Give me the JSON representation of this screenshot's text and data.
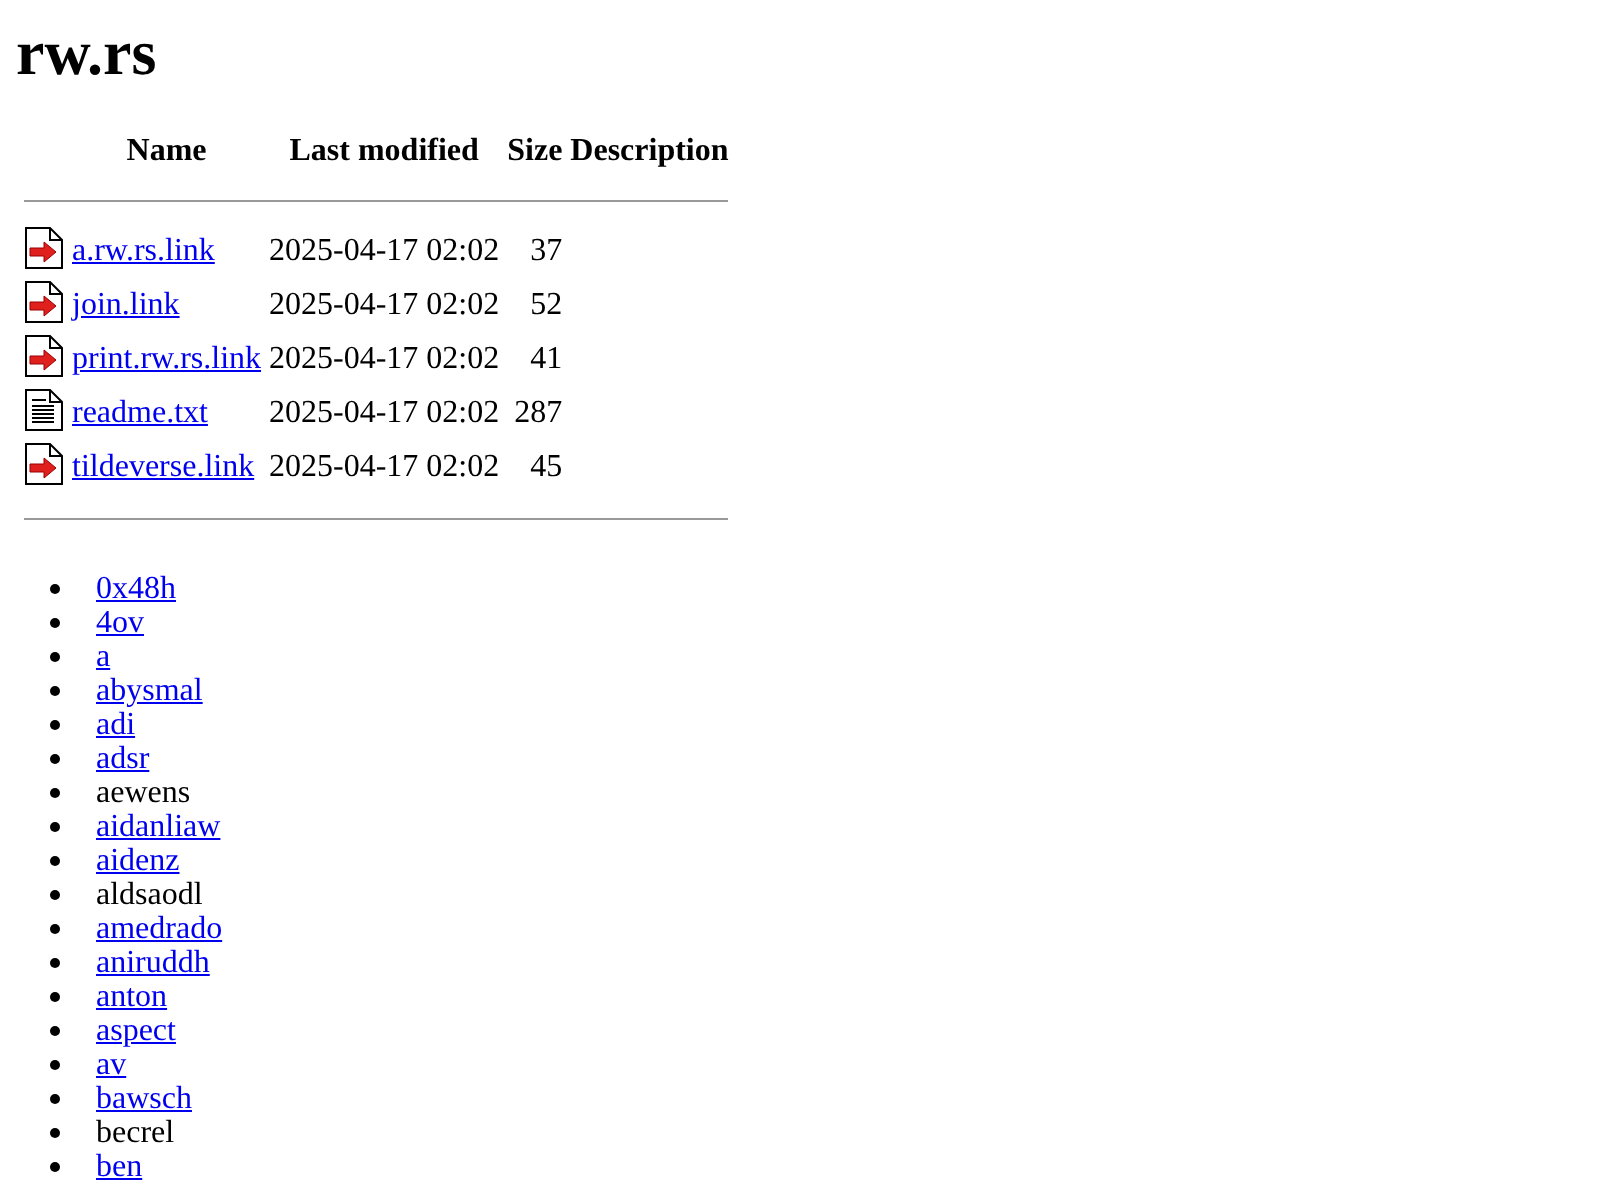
{
  "title": "rw.rs",
  "table": {
    "columns": [
      "Name",
      "Last modified",
      "Size",
      "Description"
    ],
    "rows": [
      {
        "kind": "link",
        "name": "a.rw.rs.link",
        "modified": "2025-04-17 02:02",
        "size": "37"
      },
      {
        "kind": "link",
        "name": "join.link",
        "modified": "2025-04-17 02:02",
        "size": "52"
      },
      {
        "kind": "link",
        "name": "print.rw.rs.link",
        "modified": "2025-04-17 02:02",
        "size": "41"
      },
      {
        "kind": "text",
        "name": "readme.txt",
        "modified": "2025-04-17 02:02",
        "size": "287"
      },
      {
        "kind": "link",
        "name": "tildeverse.link",
        "modified": "2025-04-17 02:02",
        "size": "45"
      }
    ]
  },
  "users": [
    {
      "name": "0x48h",
      "linked": true
    },
    {
      "name": "4ov",
      "linked": true
    },
    {
      "name": "a",
      "linked": true
    },
    {
      "name": "abysmal",
      "linked": true
    },
    {
      "name": "adi",
      "linked": true
    },
    {
      "name": "adsr",
      "linked": true
    },
    {
      "name": "aewens",
      "linked": false
    },
    {
      "name": "aidanliaw",
      "linked": true
    },
    {
      "name": "aidenz",
      "linked": true
    },
    {
      "name": "aldsaodl",
      "linked": false
    },
    {
      "name": "amedrado",
      "linked": true
    },
    {
      "name": "aniruddh",
      "linked": true
    },
    {
      "name": "anton",
      "linked": true
    },
    {
      "name": "aspect",
      "linked": true
    },
    {
      "name": "av",
      "linked": true
    },
    {
      "name": "bawsch",
      "linked": true
    },
    {
      "name": "becrel",
      "linked": false
    },
    {
      "name": "ben",
      "linked": true
    }
  ]
}
